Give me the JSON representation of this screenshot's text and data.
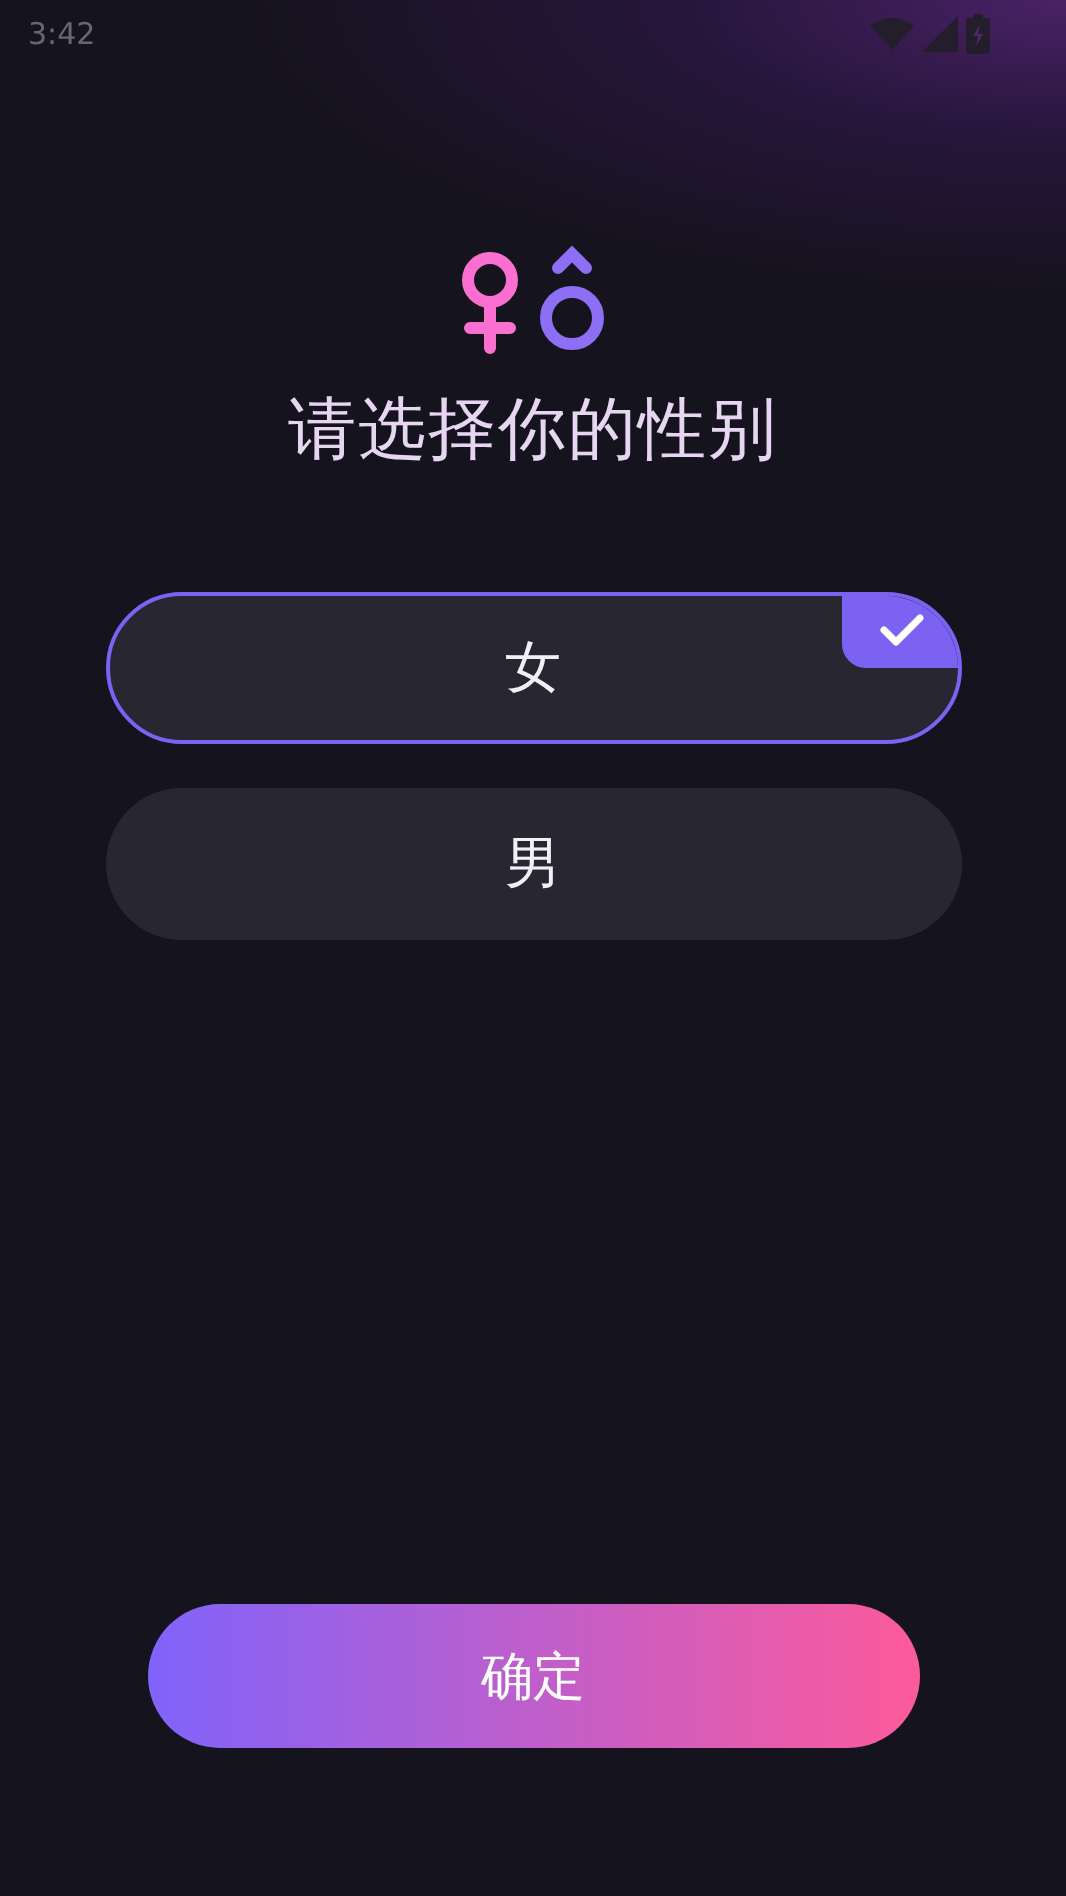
{
  "status_bar": {
    "time": "3:42"
  },
  "title": "请选择你的性别",
  "options": [
    {
      "label": "女",
      "selected": true
    },
    {
      "label": "男",
      "selected": false
    }
  ],
  "confirm_button": "确定"
}
